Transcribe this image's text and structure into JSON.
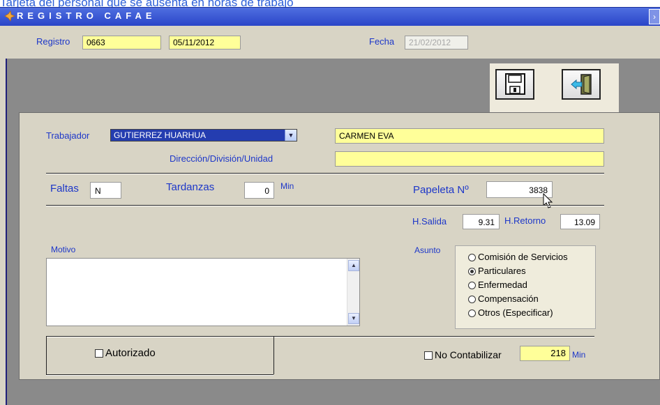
{
  "background_text": "Tarjeta del personal que se ausenta en horas de trabajo",
  "window": {
    "title": "REGISTRO  CAFAE"
  },
  "header": {
    "registro_label": "Registro",
    "registro_value": "0663",
    "registro_date": "05/11/2012",
    "fecha_label": "Fecha",
    "fecha_value": "21/02/2012"
  },
  "toolbar": {
    "save_icon": "floppy-disk-icon",
    "exit_icon": "exit-door-icon"
  },
  "form": {
    "trabajador_label": "Trabajador",
    "trabajador_value": "GUTIERREZ HUARHUA",
    "trabajador_name": "CARMEN EVA",
    "direccion_label": "Dirección/División/Unidad",
    "direccion_value": "",
    "faltas_label": "Faltas",
    "faltas_value": "N",
    "tardanzas_label": "Tardanzas",
    "tardanzas_value": "0",
    "tardanzas_unit": "Min",
    "papeleta_label": "Papeleta Nº",
    "papeleta_value": "3838",
    "hsalida_label": "H.Salida",
    "hsalida_value": "9.31",
    "hretorno_label": "H.Retorno",
    "hretorno_value": "13.09",
    "motivo_label": "Motivo",
    "motivo_value": "",
    "asunto_label": "Asunto",
    "asunto_options": [
      {
        "label": "Comisión de Servicios",
        "selected": false
      },
      {
        "label": "Particulares",
        "selected": true
      },
      {
        "label": "Enfermedad",
        "selected": false
      },
      {
        "label": "Compensación",
        "selected": false
      },
      {
        "label": "Otros (Especificar)",
        "selected": false
      }
    ],
    "autorizado_label": "Autorizado",
    "autorizado_checked": false,
    "no_contabilizar_label": "No Contabilizar",
    "no_contabilizar_checked": false,
    "minutes_value": "218",
    "minutes_unit": "Min"
  },
  "colors": {
    "title_bar": "#2a45c8",
    "label_blue": "#1d37c9",
    "field_yellow": "#ffff99",
    "panel_beige": "#d8d4c5",
    "dark_gray": "#8a8a8a"
  }
}
